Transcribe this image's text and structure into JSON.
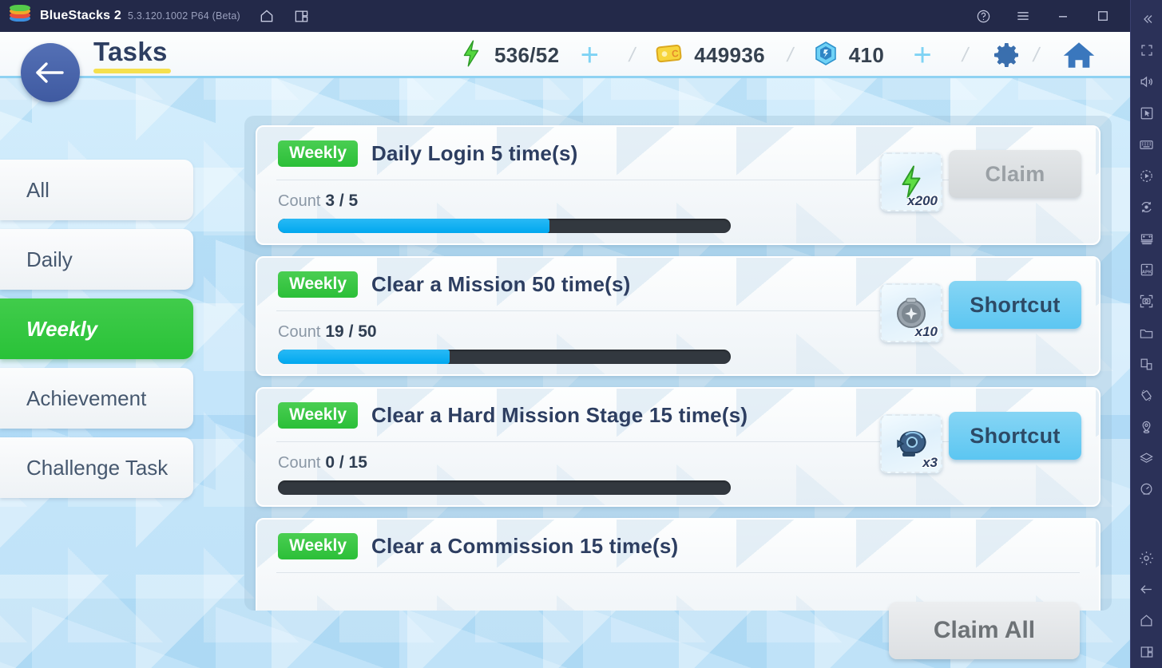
{
  "window": {
    "brand": "BlueStacks 2",
    "version": "5.3.120.1002 P64 (Beta)",
    "titlebar_icons": [
      "home-icon",
      "multi-instance-icon"
    ],
    "controls": [
      "help-icon",
      "menu-icon",
      "minimize-icon",
      "maximize-icon",
      "close-icon"
    ]
  },
  "sidebar_tools": [
    "collapse-icon",
    "fullscreen-icon",
    "volume-icon",
    "pointer-icon",
    "keyboard-icon",
    "macro-record-icon",
    "rotate-icon",
    "gamepad-icon",
    "apk-install-icon",
    "screenshot-icon",
    "folder-icon",
    "copy-instance-icon",
    "shake-icon",
    "location-icon",
    "layers-icon",
    "performance-icon",
    "settings-icon",
    "back-icon",
    "home-icon",
    "recents-icon"
  ],
  "game": {
    "page_title": "Tasks",
    "back_label": "back-arrow",
    "currency": [
      {
        "id": "energy",
        "icon": "lightning-bolt-icon",
        "value": "536/52",
        "plus": "+"
      },
      {
        "id": "ticket",
        "icon": "ticket-icon",
        "value": "449936"
      },
      {
        "id": "gem",
        "icon": "gem-icon",
        "value": "410",
        "plus": "+"
      }
    ],
    "header_buttons": [
      {
        "id": "settings",
        "icon": "gear-icon"
      },
      {
        "id": "home",
        "icon": "home-icon"
      }
    ],
    "tabs": [
      {
        "label": "All",
        "active": false
      },
      {
        "label": "Daily",
        "active": false
      },
      {
        "label": "Weekly",
        "active": true
      },
      {
        "label": "Achievement",
        "active": false
      },
      {
        "label": "Challenge Task",
        "active": false
      }
    ],
    "count_label": "Count",
    "claim_all_label": "Claim All",
    "tasks": [
      {
        "badge": "Weekly",
        "title": "Daily Login 5 time(s)",
        "current": 3,
        "goal": 5,
        "count_text": "3 / 5",
        "progress_pct": 60,
        "reward_icon": "lightning-bolt-icon",
        "reward_mult": "x200",
        "action_label": "Claim",
        "action_state": "disabled"
      },
      {
        "badge": "Weekly",
        "title": "Clear a Mission 50 time(s)",
        "current": 19,
        "goal": 50,
        "count_text": "19 / 50",
        "progress_pct": 38,
        "reward_icon": "silver-orb-icon",
        "reward_mult": "x10",
        "action_label": "Shortcut",
        "action_state": "enabled"
      },
      {
        "badge": "Weekly",
        "title": "Clear a Hard Mission Stage 15 time(s)",
        "current": 0,
        "goal": 15,
        "count_text": "0 / 15",
        "progress_pct": 0,
        "reward_icon": "blue-helmet-icon",
        "reward_mult": "x3",
        "action_label": "Shortcut",
        "action_state": "enabled"
      },
      {
        "badge": "Weekly",
        "title": "Clear a Commission 15 time(s)",
        "current": null,
        "goal": null,
        "count_text": "",
        "progress_pct": 0,
        "reward_icon": "",
        "reward_mult": "",
        "action_label": "",
        "action_state": "hidden"
      }
    ]
  },
  "colors": {
    "titlebar": "#232949",
    "sidebar": "#2b3158",
    "accent_green": "#2bbf38",
    "accent_blue": "#5cc6f2",
    "progress_fill": "#00a8ef",
    "progress_track": "#32383f",
    "title_text": "#2d3e61",
    "underline_yellow": "#f5e04f"
  }
}
